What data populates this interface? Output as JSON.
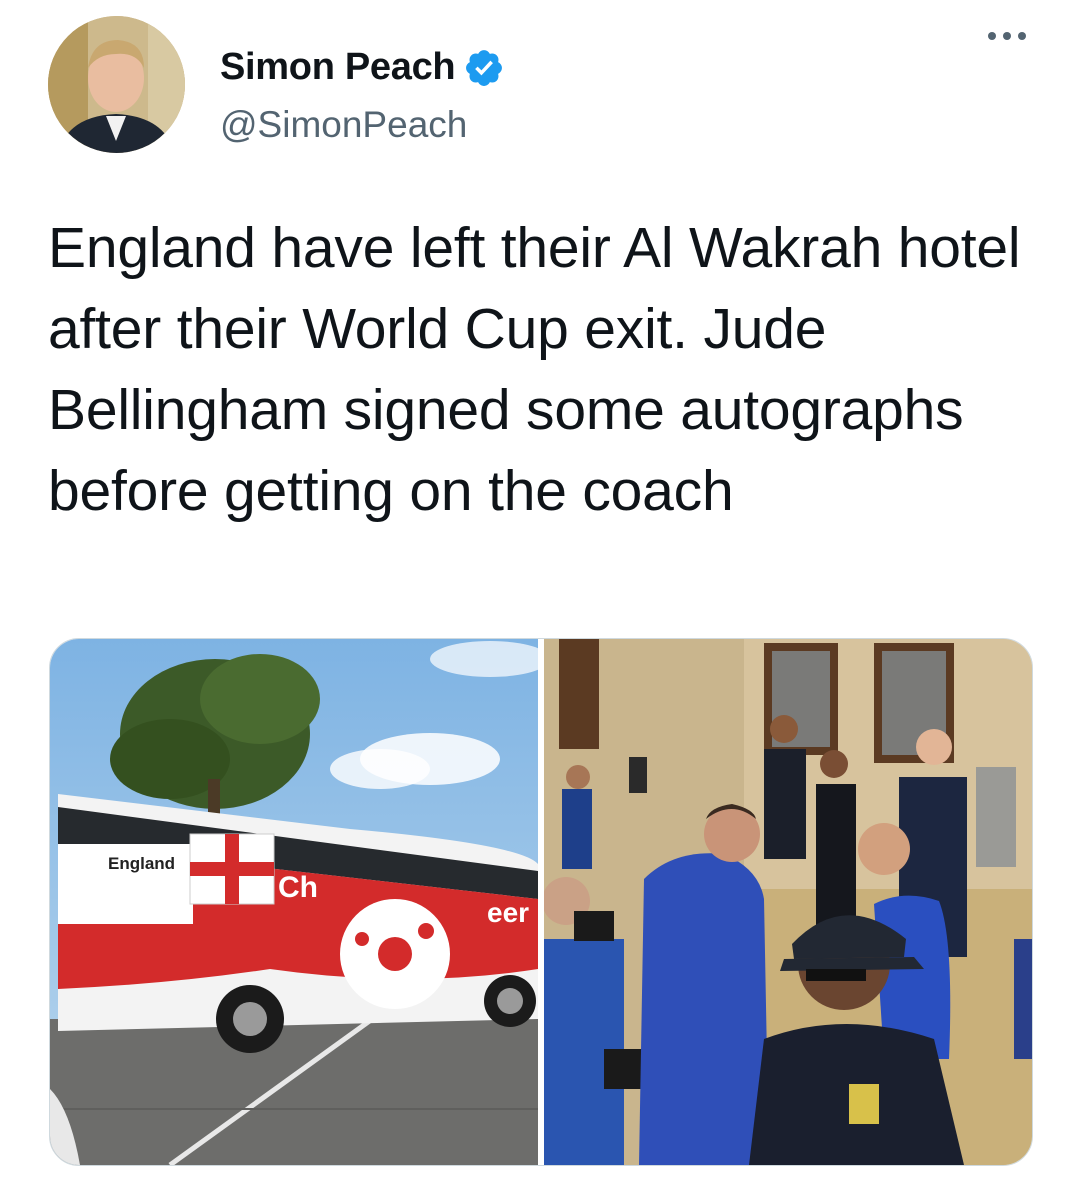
{
  "author": {
    "display_name": "Simon Peach",
    "handle": "@SimonPeach",
    "verified": true,
    "avatar_icon": "profile-photo",
    "verified_icon": "verified-badge-icon"
  },
  "tweet": {
    "text": "England have left their Al Wakrah hotel after their World Cup exit. Jude Bellingham signed some autographs before getting on the coach"
  },
  "media": {
    "photos": [
      {
        "id": "photo-bus",
        "bus_texts": {
          "brand": "England",
          "slogan_left": "Ch",
          "slogan_right": "eer"
        }
      },
      {
        "id": "photo-team"
      }
    ]
  },
  "colors": {
    "accent": "#1d9bf0",
    "text_primary": "#0f1419",
    "text_secondary": "#536471",
    "border": "#cfd9de"
  }
}
